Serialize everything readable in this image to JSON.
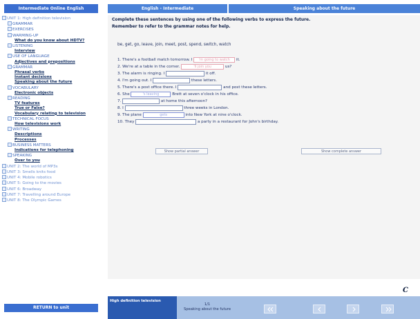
{
  "sidebar": {
    "title": "Intermediate Online English",
    "footer_button": "RETURN to unit",
    "tree": [
      {
        "type": "unit",
        "label": "UNIT 1: High definition television"
      },
      {
        "type": "sec",
        "label": "GRAMMAR"
      },
      {
        "type": "sec",
        "label": "EXERCISES"
      },
      {
        "type": "sec",
        "label": "WARMING-UP"
      },
      {
        "type": "item",
        "label": "What do you know about HDTV?"
      },
      {
        "type": "sec",
        "label": "LISTENING"
      },
      {
        "type": "item",
        "label": "Interview"
      },
      {
        "type": "sec",
        "label": "USE OF LANGUAGE"
      },
      {
        "type": "item",
        "label": "Adjectives and prepositions"
      },
      {
        "type": "sec",
        "label": "GRAMMAR"
      },
      {
        "type": "item",
        "label": "Phrasal verbs"
      },
      {
        "type": "item",
        "label": "Instant decisions"
      },
      {
        "type": "item",
        "label": "Speaking about the future"
      },
      {
        "type": "sec",
        "label": "VOCABULARY"
      },
      {
        "type": "item",
        "label": "Electronic objects"
      },
      {
        "type": "sec",
        "label": "READING"
      },
      {
        "type": "item",
        "label": "TV features"
      },
      {
        "type": "item",
        "label": "True or False?"
      },
      {
        "type": "item",
        "label": "Vocabulary relating to television"
      },
      {
        "type": "sec",
        "label": "TECHNICAL FOCUS"
      },
      {
        "type": "item",
        "label": "How televisions work"
      },
      {
        "type": "sec",
        "label": "WRITING"
      },
      {
        "type": "item",
        "label": "Descriptions"
      },
      {
        "type": "item",
        "label": "Processes"
      },
      {
        "type": "sec",
        "label": "BUSINESS MATTERS"
      },
      {
        "type": "item",
        "label": "Indications for telephoning"
      },
      {
        "type": "sec",
        "label": "SPEAKING"
      },
      {
        "type": "item",
        "label": "Over to you"
      },
      {
        "type": "unit",
        "label": "UNIT 2: The world of MP3s"
      },
      {
        "type": "unit",
        "label": "UNIT 3: Smells knits food"
      },
      {
        "type": "unit",
        "label": "UNIT 4: Mobile robotics"
      },
      {
        "type": "unit",
        "label": "UNIT 5: Going to the movies"
      },
      {
        "type": "unit",
        "label": "UNIT 6: Broadway"
      },
      {
        "type": "unit",
        "label": "UNIT 7: Travelling around Europe"
      },
      {
        "type": "unit",
        "label": "UNIT 8: The Olympic Games"
      }
    ]
  },
  "tabs": {
    "course": "English - Intermediate",
    "topic": "Speaking about the future"
  },
  "exercise": {
    "instruction_1": "Complete these sentences by using one of the following verbs to express the future.",
    "instruction_2": "Remember to refer to the grammar notes for help.",
    "verbs": "be, get, go, leave, join, meet, post, spend, switch, watch",
    "sentences": [
      {
        "num": "1.",
        "pre": "There's a football match tomorrow. I",
        "answer": "'m going to watch",
        "answer_state": "wrong",
        "post": "it."
      },
      {
        "num": "2.",
        "pre": "We're at a table in the corner.",
        "answer": "'ll join you",
        "answer_state": "wrong",
        "post": "us?"
      },
      {
        "num": "3.",
        "pre": "The alarm is ringing. I",
        "answer": "",
        "answer_state": "empty",
        "post": "it off."
      },
      {
        "num": "4.",
        "pre": "I'm going out. I",
        "answer": "",
        "answer_state": "empty",
        "post": "these letters."
      },
      {
        "num": "5.",
        "pre": "There's a post office there. I",
        "answer": "",
        "answer_state": "empty",
        "post": "and post these letters."
      },
      {
        "num": "6.",
        "pre": "She",
        "answer": "'s leaving",
        "answer_state": "correct",
        "post": "Brett at seven o'clock in his office."
      },
      {
        "num": "7.",
        "pre": "",
        "answer": "",
        "answer_state": "empty",
        "post": "at home this afternoon?"
      },
      {
        "num": "8.",
        "pre": "I",
        "answer": "",
        "answer_state": "empty",
        "post": "three weeks in London."
      },
      {
        "num": "9.",
        "pre": "The plane",
        "answer": "gets",
        "answer_state": "correct",
        "post": "into New York at nine o'clock."
      },
      {
        "num": "10.",
        "pre": "They",
        "answer": "",
        "answer_state": "empty",
        "post": "a party in a restaurant for John's birthday."
      }
    ],
    "partial_button": "Show partial answer",
    "complete_button": "Show complete answer"
  },
  "footer": {
    "title": "High definition television",
    "page": "1/1",
    "page_topic": "Speaking about the future",
    "logo_letter": "C"
  },
  "colors": {
    "accent_blue": "#3a6ed0",
    "tab_blue": "#4a82d8",
    "footer_blue": "#a6c0e4",
    "wrong_answer": "#e6a4b0",
    "correct_answer": "#7f8fd6"
  }
}
